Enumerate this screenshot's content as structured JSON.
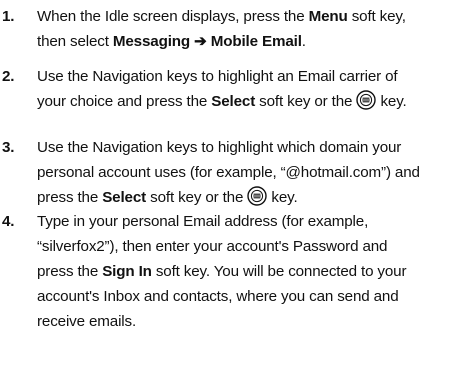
{
  "steps": [
    {
      "number": "1.",
      "line1_a": "When the Idle screen displays, press the ",
      "line1_b": "Menu",
      "line1_c": " soft key,",
      "line2_a": "then select ",
      "line2_b": "Messaging ➔ Mobile Email",
      "line2_c": "."
    },
    {
      "number": "2.",
      "line1": "Use the Navigation keys to highlight an Email carrier of",
      "line2_a": "your choice and press the ",
      "line2_b": "Select",
      "line2_c": " soft key or the ",
      "line2_d": " key."
    },
    {
      "number": "3.",
      "line1": "Use the Navigation keys to highlight which domain your",
      "line2": "personal account uses (for example, “@hotmail.com”) and",
      "line3_a": "press the ",
      "line3_b": "Select",
      "line3_c": " soft key or the ",
      "line3_d": " key."
    },
    {
      "number": "4.",
      "line1": "Type in your personal Email address (for example,",
      "line2": "“silverfox2”), then enter your account's Password and",
      "line3_a": "press the ",
      "line3_b": "Sign In",
      "line3_c": " soft key. You will be connected to your",
      "line4": "account's Inbox and contacts, where you can send and",
      "line5": "receive emails."
    }
  ],
  "icons": {
    "select_key": "ok-key-icon"
  }
}
